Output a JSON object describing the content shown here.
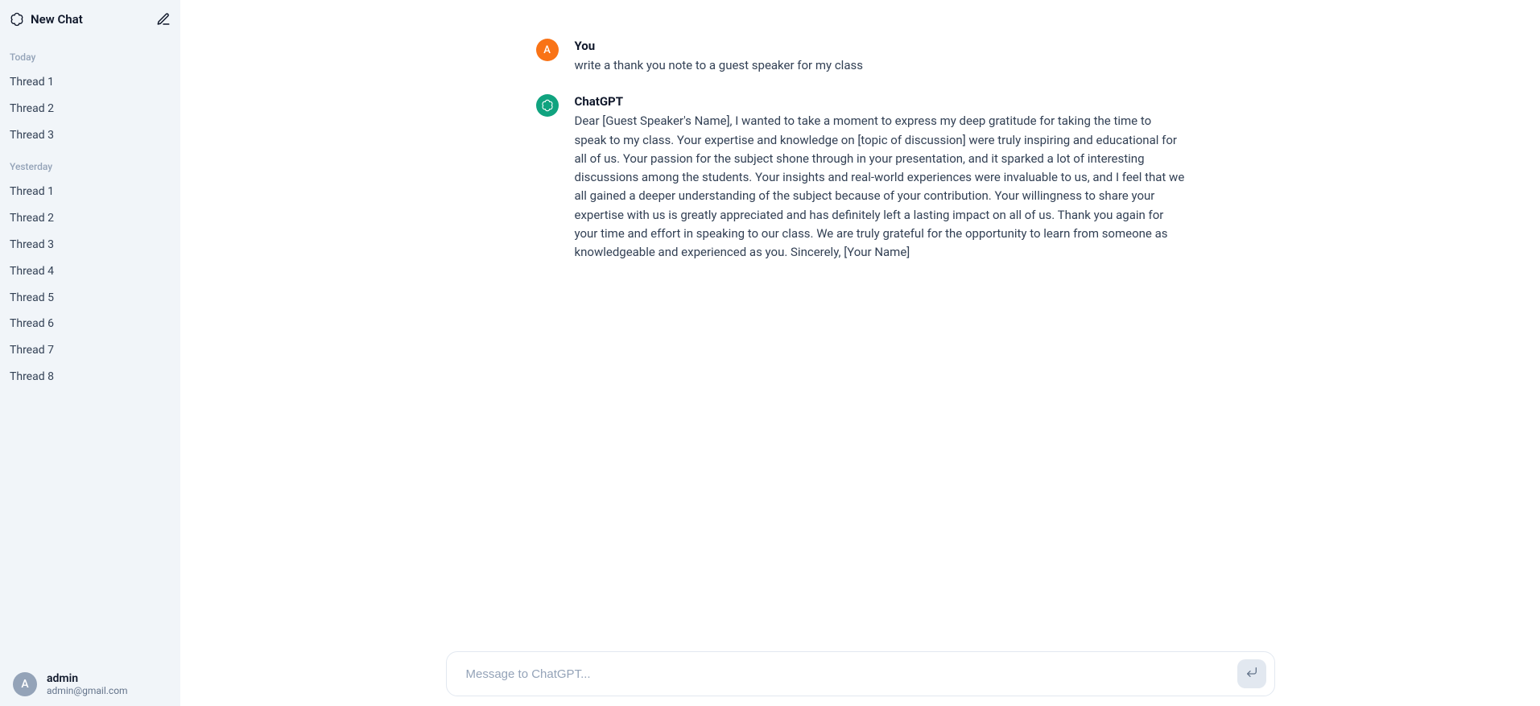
{
  "sidebar": {
    "new_chat_label": "New Chat",
    "groups": [
      {
        "label": "Today",
        "items": [
          "Thread 1",
          "Thread 2",
          "Thread 3"
        ]
      },
      {
        "label": "Yesterday",
        "items": [
          "Thread 1",
          "Thread 2",
          "Thread 3",
          "Thread 4",
          "Thread 5",
          "Thread 6",
          "Thread 7",
          "Thread 8"
        ]
      }
    ],
    "user": {
      "initial": "A",
      "name": "admin",
      "email": "admin@gmail.com"
    }
  },
  "conversation": {
    "user_avatar_initial": "A",
    "user_label": "You",
    "user_message": "write a thank you note to a guest speaker for my class",
    "assistant_label": "ChatGPT",
    "assistant_message": "Dear [Guest Speaker's Name], I wanted to take a moment to express my deep gratitude for taking the time to speak to my class. Your expertise and knowledge on [topic of discussion] were truly inspiring and educational for all of us. Your passion for the subject shone through in your presentation, and it sparked a lot of interesting discussions among the students. Your insights and real-world experiences were invaluable to us, and I feel that we all gained a deeper understanding of the subject because of your contribution. Your willingness to share your expertise with us is greatly appreciated and has definitely left a lasting impact on all of us. Thank you again for your time and effort in speaking to our class. We are truly grateful for the opportunity to learn from someone as knowledgeable and experienced as you. Sincerely, [Your Name]"
  },
  "composer": {
    "placeholder": "Message to ChatGPT..."
  }
}
